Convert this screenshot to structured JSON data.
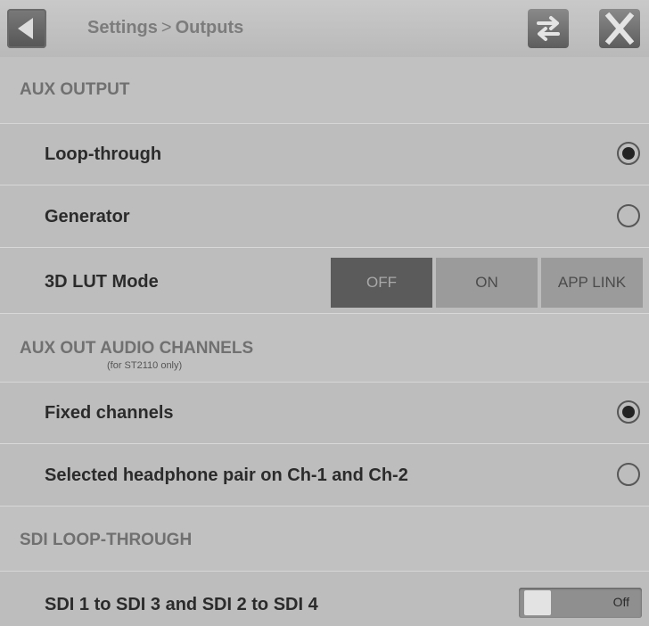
{
  "header": {
    "breadcrumb_parent": "Settings",
    "breadcrumb_separator": ">",
    "breadcrumb_current": "Outputs"
  },
  "aux_output": {
    "title": "AUX OUTPUT",
    "loop_through": {
      "label": "Loop-through",
      "selected": true
    },
    "generator": {
      "label": "Generator",
      "selected": false
    },
    "lut_mode": {
      "label": "3D LUT Mode",
      "options": [
        "OFF",
        "ON",
        "APP LINK"
      ],
      "selected": "OFF"
    }
  },
  "aux_audio": {
    "title": "AUX OUT AUDIO CHANNELS",
    "subtitle": "(for ST2110 only)",
    "fixed": {
      "label": "Fixed channels",
      "selected": true
    },
    "headphone": {
      "label": "Selected headphone pair on Ch-1 and Ch-2",
      "selected": false
    }
  },
  "sdi_loop": {
    "title": "SDI LOOP-THROUGH",
    "mapping": {
      "label": "SDI 1 to SDI 3 and SDI 2 to SDI 4",
      "state": "Off"
    }
  }
}
